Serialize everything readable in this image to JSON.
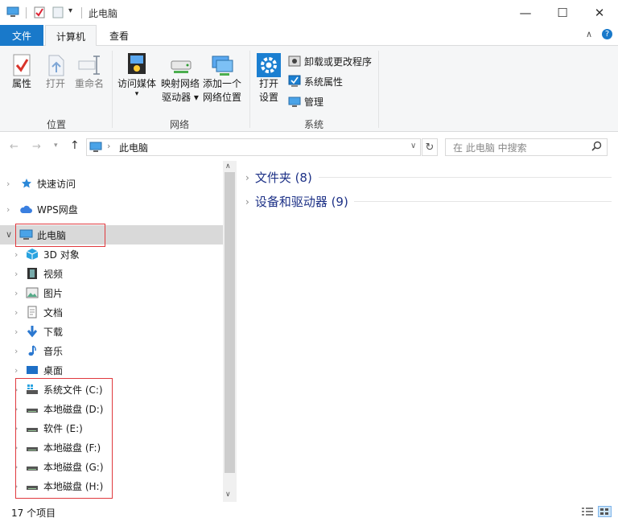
{
  "window": {
    "title": "此电脑",
    "minimize": "—",
    "maximize": "☐",
    "close": "✕",
    "help": "?",
    "collapse": "∧"
  },
  "tabs": {
    "file": "文件",
    "computer": "计算机",
    "view": "查看"
  },
  "ribbon": {
    "location": {
      "label": "位置",
      "properties": "属性",
      "open": "打开",
      "rename": "重命名"
    },
    "network": {
      "label": "网络",
      "media_l1": "访问媒体",
      "map_l1": "映射网络",
      "map_l2": "驱动器 ▾",
      "add_l1": "添加一个",
      "add_l2": "网络位置"
    },
    "system": {
      "label": "系统",
      "open_l1": "打开",
      "open_l2": "设置",
      "uninstall": "卸载或更改程序",
      "sysprops": "系统属性",
      "manage": "管理"
    }
  },
  "address": {
    "path": "此电脑",
    "search_placeholder": "在 此电脑 中搜索"
  },
  "nav": {
    "quick": "快速访问",
    "wps": "WPS网盘",
    "thispc": "此电脑",
    "children": [
      "3D 对象",
      "视频",
      "图片",
      "文档",
      "下载",
      "音乐",
      "桌面"
    ],
    "drives": [
      "系统文件 (C:)",
      "本地磁盘 (D:)",
      "软件 (E:)",
      "本地磁盘 (F:)",
      "本地磁盘 (G:)",
      "本地磁盘 (H:)"
    ]
  },
  "content": {
    "folders": "文件夹 (8)",
    "devices": "设备和驱动器 (9)"
  },
  "status": {
    "count": "17 个项目"
  },
  "colors": {
    "accent": "#1979ca",
    "highlight": "#e0393e",
    "selected": "#d9d9d9"
  }
}
